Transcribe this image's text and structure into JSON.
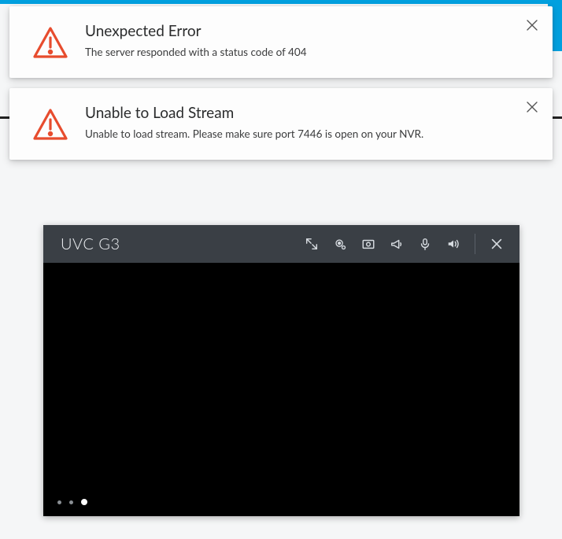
{
  "alerts": [
    {
      "title": "Unexpected Error",
      "message": "The server responded with a status code of 404"
    },
    {
      "title": "Unable to Load Stream",
      "message": "Unable to load stream. Please make sure port 7446 is open on your NVR."
    }
  ],
  "player": {
    "title": "UVC G3"
  },
  "colors": {
    "accent": "#00a0df",
    "warning": "#e74c2e",
    "header": "#3a3f45"
  }
}
